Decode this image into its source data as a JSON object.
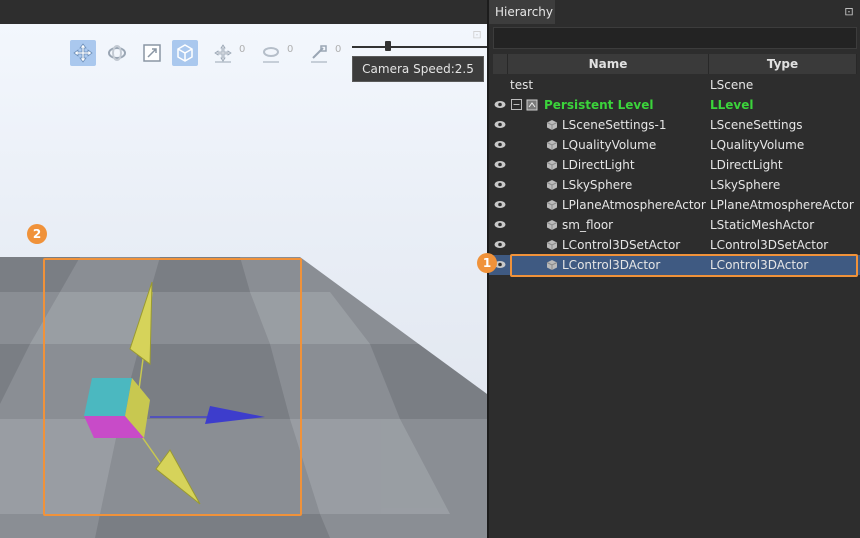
{
  "viewport": {
    "toolbar": {
      "move_count": "0",
      "rotate_count": "0",
      "scale_count": "0"
    },
    "camera_speed_label": "Camera Speed:2.5",
    "callout_badge": "2"
  },
  "hierarchy": {
    "tab_title": "Hierarchy",
    "columns": {
      "name": "Name",
      "type": "Type"
    },
    "callout_badge": "1",
    "rows": [
      {
        "name": "test",
        "type": "LScene"
      },
      {
        "name": "Persistent Level",
        "type": "LLevel"
      },
      {
        "name": "LSceneSettings-1",
        "type": "LSceneSettings"
      },
      {
        "name": "LQualityVolume",
        "type": "LQualityVolume"
      },
      {
        "name": "LDirectLight",
        "type": "LDirectLight"
      },
      {
        "name": "LSkySphere",
        "type": "LSkySphere"
      },
      {
        "name": "LPlaneAtmosphereActor",
        "type": "LPlaneAtmosphereActor"
      },
      {
        "name": "sm_floor",
        "type": "LStaticMeshActor"
      },
      {
        "name": "LControl3DSetActor",
        "type": "LControl3DSetActor"
      },
      {
        "name": "LControl3DActor",
        "type": "LControl3DActor"
      }
    ]
  },
  "colors": {
    "accent_callout": "#f0923a",
    "selection": "#3f5a82",
    "level_text": "#3bd43b"
  }
}
